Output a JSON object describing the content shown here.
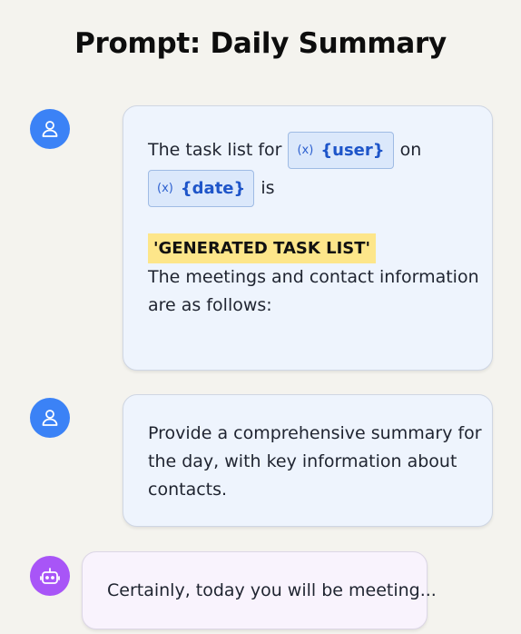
{
  "page": {
    "title": "Prompt: Daily Summary"
  },
  "messages": [
    {
      "role": "user",
      "avatar_icon": "user-icon",
      "parts": {
        "t1": "The task list for",
        "var_user": "{user}",
        "t2": "on",
        "var_date": "{date}",
        "t3": "is",
        "highlight": "'GENERATED TASK LIST'",
        "t4_line1": "The meetings and contact information",
        "t4_line2": "are as follows:"
      }
    },
    {
      "role": "user",
      "avatar_icon": "user-icon",
      "lines": [
        "Provide a comprehensive summary for",
        "the day, with key information about",
        "contacts."
      ]
    },
    {
      "role": "assistant",
      "avatar_icon": "bot-icon",
      "text": "Certainly, today you will be meeting..."
    }
  ],
  "variable_icon": "variable-icon",
  "colors": {
    "background": "#f4f3ee",
    "user_avatar": "#3b82f6",
    "bot_avatar": "#a855f7",
    "user_bubble": "#eef4fd",
    "bot_bubble": "#f9f3fd",
    "chip_bg": "#dbe8fb",
    "chip_text": "#1e55c9",
    "highlight": "#fde68a"
  }
}
